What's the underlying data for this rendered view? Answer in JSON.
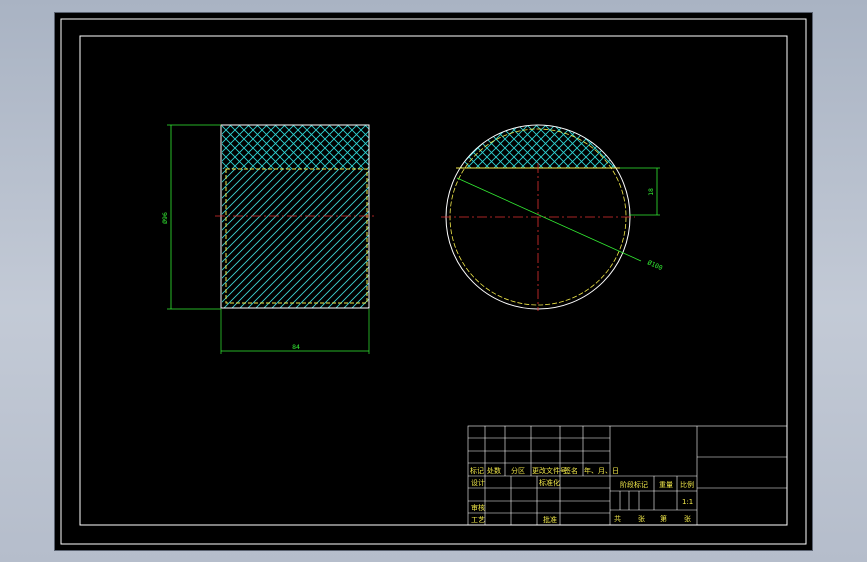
{
  "colors": {
    "frame": "#ffffff",
    "outline_front": "#f2e94a",
    "outline_side": "#ffffff",
    "hatch_cross": "#2fd4d4",
    "hatch_diag": "#3fd4d4",
    "dimension": "#33ee33",
    "centerline": "#e03030",
    "title_block_text": "#f2e94a"
  },
  "front_view": {
    "height_dim": "Ø96",
    "width_dim": "84"
  },
  "side_view": {
    "diameter_dim": "Ø100",
    "flat_dim": "18"
  },
  "title_block": {
    "rev_headers": [
      "标记",
      "处数",
      "分区",
      "更改文件号",
      "签名",
      "年、月、日"
    ],
    "design_label": "设计",
    "standardize_label": "标准化",
    "review_label": "审核",
    "process_label": "工艺",
    "approve_label": "批准",
    "stage_mark_label": "阶段标记",
    "weight_label": "重量",
    "scale_label": "比例",
    "scale_value": "1:1",
    "sheets_total_label": "共",
    "sheets_total_unit": "张",
    "sheet_no_label": "第",
    "sheet_no_unit": "张"
  }
}
